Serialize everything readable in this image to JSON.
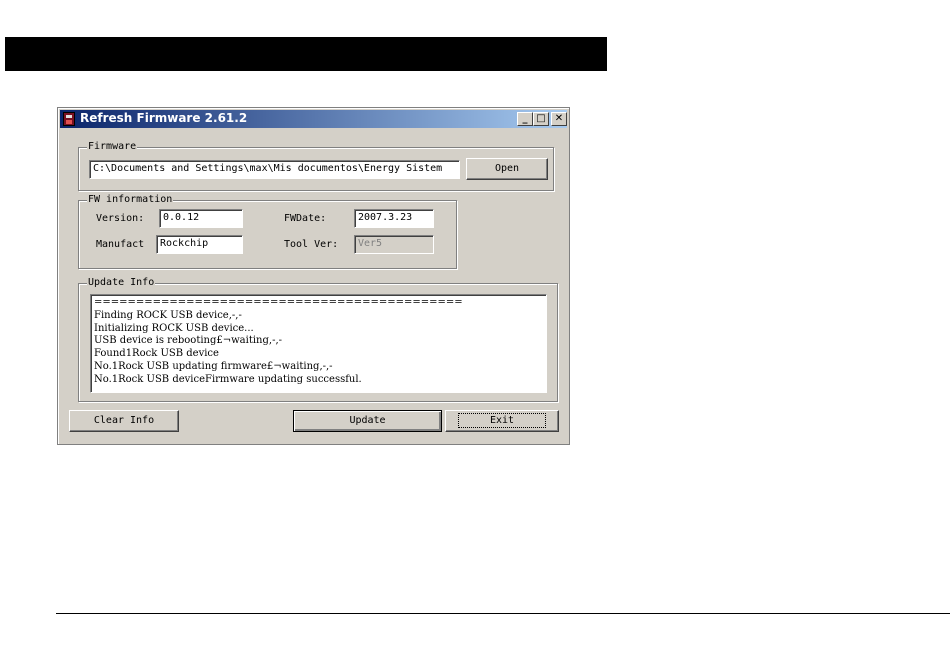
{
  "window": {
    "title": "Refresh Firmware 2.61.2",
    "caption_buttons": {
      "minimize": "_",
      "maximize": "□",
      "close": "✕"
    }
  },
  "firmware": {
    "group_label": "Firmware",
    "path": "C:\\Documents and Settings\\max\\Mis documentos\\Energy Sistem",
    "open_label": "Open"
  },
  "fw_info": {
    "group_label": "FW information",
    "version_label": "Version:",
    "version_value": "0.0.12",
    "fwdate_label": "FWDate:",
    "fwdate_value": "2007.3.23",
    "manufact_label": "Manufact",
    "manufact_value": "Rockchip",
    "toolver_label": "Tool Ver:",
    "toolver_value": "Ver5"
  },
  "update_info": {
    "group_label": "Update Info",
    "lines": [
      "============================================",
      "Finding ROCK USB device,-,-",
      "Initializing ROCK USB device...",
      "USB device is rebooting£¬waiting,-,-",
      "Found1Rock USB device",
      "No.1Rock USB updating firmware£¬waiting,-,-",
      "No.1Rock USB deviceFirmware updating successful."
    ]
  },
  "buttons": {
    "clear_info": "Clear Info",
    "update": "Update",
    "exit": "Exit"
  }
}
